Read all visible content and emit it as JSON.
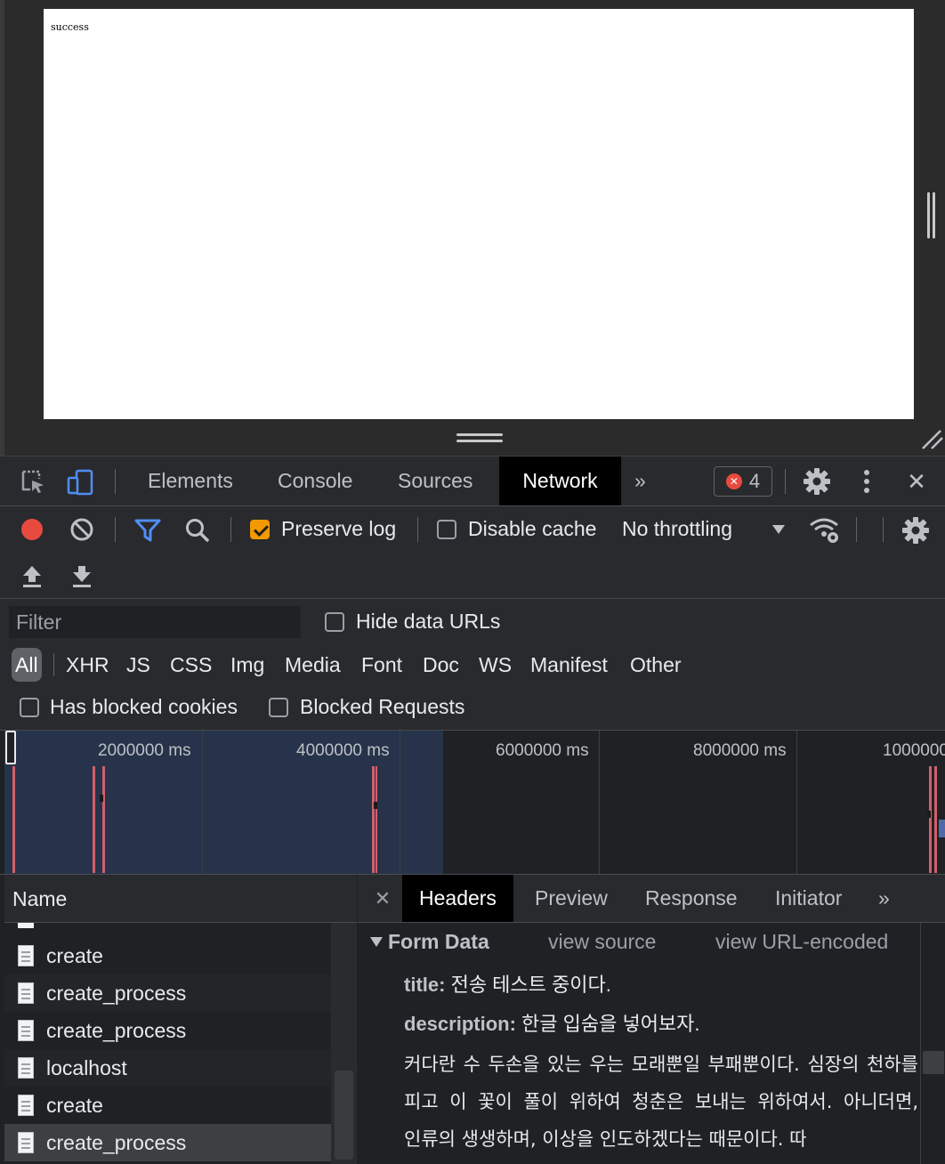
{
  "page": {
    "body_text": "success"
  },
  "devtools": {
    "tabs": [
      "Elements",
      "Console",
      "Sources",
      "Network"
    ],
    "active_tab": "Network",
    "more_tabs_label": "»",
    "error_count": "4",
    "close_label": "✕"
  },
  "network_toolbar": {
    "preserve_log_label": "Preserve log",
    "preserve_log_checked": true,
    "disable_cache_label": "Disable cache",
    "disable_cache_checked": false,
    "throttling_value": "No throttling"
  },
  "filter": {
    "placeholder": "Filter",
    "hide_data_urls_label": "Hide data URLs",
    "types": [
      "All",
      "XHR",
      "JS",
      "CSS",
      "Img",
      "Media",
      "Font",
      "Doc",
      "WS",
      "Manifest",
      "Other"
    ],
    "active_type": "All",
    "has_blocked_cookies_label": "Has blocked cookies",
    "blocked_requests_label": "Blocked Requests"
  },
  "overview": {
    "tick_labels": [
      "2000000 ms",
      "4000000 ms",
      "6000000 ms",
      "8000000 ms",
      "1000000"
    ]
  },
  "requests": {
    "header": "Name",
    "items": [
      "create",
      "create_process",
      "create_process",
      "localhost",
      "create",
      "create_process"
    ],
    "selected_index": 5
  },
  "details": {
    "tabs": [
      "Headers",
      "Preview",
      "Response",
      "Initiator"
    ],
    "active_tab": "Headers",
    "more_label": "»",
    "section_title": "Form Data",
    "view_source_label": "view source",
    "view_url_encoded_label": "view URL-encoded",
    "fields": {
      "title_key": "title:",
      "title_value": "전송 테스트 중이다.",
      "description_key": "description:",
      "description_value": "한글 입숨을 넣어보자.",
      "description_body": "커다란 수 두손을 있는 우는 모래뿐일 부패뿐이다. 심장의 천하를 피고 이 꽃이 풀이 위하여 청춘은 보내는 위하여서. 아니더면, 인류의 생생하며, 이상을 인도하겠다는 때문이다. 따"
    }
  },
  "colors": {
    "record": "#e94a3f",
    "filter_active": "#4f8ef7",
    "checkbox_checked": "#f29900",
    "overview_bar": "#d0606c"
  }
}
